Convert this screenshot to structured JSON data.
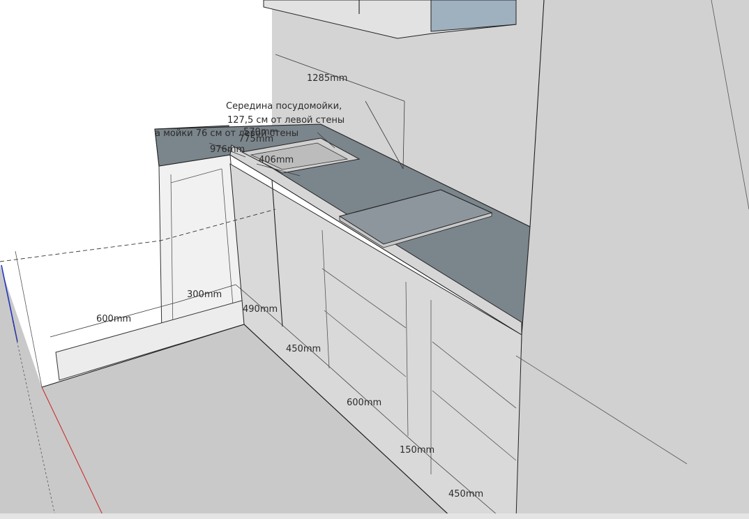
{
  "annotation": {
    "line1": "Середина посудомойки,",
    "line2": "127,5 см от левой стены",
    "line3": "а мойки 76 см от левой стены"
  },
  "dimensions": {
    "d1285": "1285mm",
    "d570": "570mm",
    "d775": "775mm",
    "d976": "976mm",
    "d406": "406mm",
    "d600_left": "600mm",
    "d300": "300mm",
    "d490": "490mm",
    "d450_a": "450mm",
    "d600_b": "600mm",
    "d150": "150mm",
    "d450_b": "450mm"
  },
  "colors": {
    "countertop": "#7b858c",
    "floor": "#c8c8c8",
    "wall": "#d4d4d4",
    "cabinet_front": "#d9d9d9",
    "hood_glass": "#9fb0bf",
    "axis_red": "#cc2222",
    "axis_blue": "#2233bb"
  }
}
